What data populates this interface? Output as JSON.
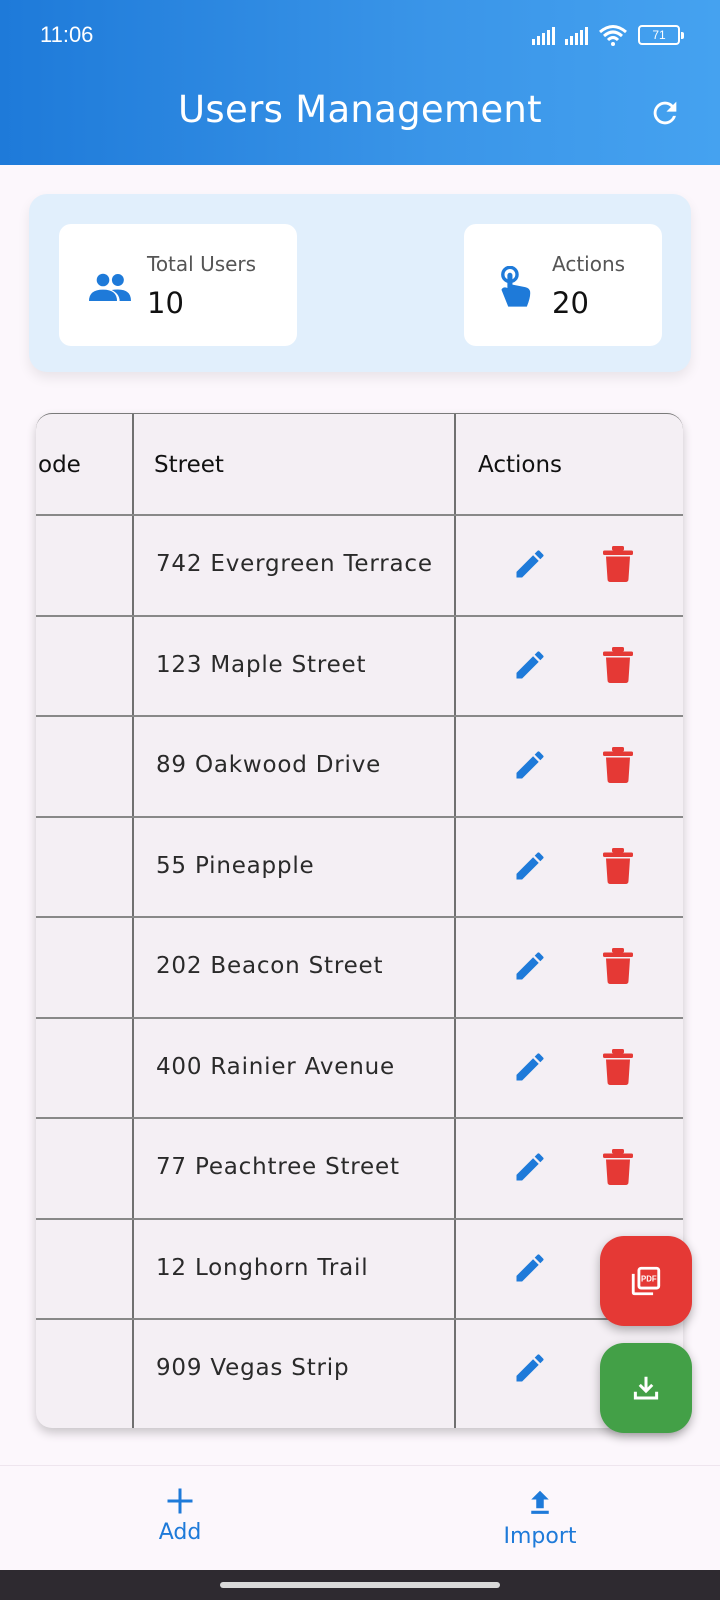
{
  "status_bar": {
    "time": "11:06",
    "battery": "71"
  },
  "header": {
    "title": "Users Management",
    "refresh_icon": "refresh-icon"
  },
  "summary": {
    "total_users": {
      "label": "Total Users",
      "value": "10",
      "icon": "people-icon"
    },
    "actions": {
      "label": "Actions",
      "value": "20",
      "icon": "touch-icon"
    }
  },
  "table": {
    "columns": [
      "ode",
      "Street",
      "Actions"
    ],
    "rows": [
      {
        "street": "742 Evergreen Terrace",
        "delete": true
      },
      {
        "street": "123 Maple Street",
        "delete": true
      },
      {
        "street": "89 Oakwood Drive",
        "delete": true
      },
      {
        "street": "55 Pineapple",
        "delete": true
      },
      {
        "street": "202 Beacon Street",
        "delete": true
      },
      {
        "street": "400 Rainier Avenue",
        "delete": true
      },
      {
        "street": "77 Peachtree Street",
        "delete": true
      },
      {
        "street": "12 Longhorn Trail",
        "delete": false
      },
      {
        "street": "909 Vegas Strip",
        "delete": false
      }
    ]
  },
  "fabs": {
    "pdf_icon": "pdf-icon",
    "download_icon": "download-icon"
  },
  "bottom_nav": {
    "add_label": "Add",
    "import_label": "Import"
  },
  "colors": {
    "primary": "#1e7ad9",
    "delete": "#e53935",
    "download": "#43a047",
    "summary_bg": "#e1effc"
  }
}
